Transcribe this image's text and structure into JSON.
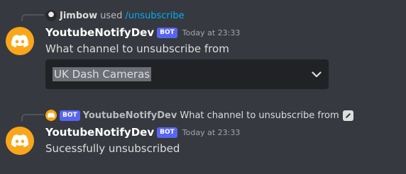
{
  "message1": {
    "reply": {
      "user": "Jimbow",
      "used_text": "used",
      "command": "/unsubscribe"
    },
    "author": "YoutubeNotifyDev",
    "bot_tag": "BOT",
    "timestamp": "Today at 23:33",
    "content": "What channel to unsubscribe from",
    "select": {
      "selected_value": "UK Dash Cameras"
    }
  },
  "message2": {
    "reply": {
      "bot_tag": "BOT",
      "author": "YoutubeNotifyDev",
      "text": "What channel to unsubscribe from"
    },
    "author": "YoutubeNotifyDev",
    "bot_tag": "BOT",
    "timestamp": "Today at 23:33",
    "content": "Sucessfully unsubscribed"
  },
  "colors": {
    "background": "#36393f",
    "blurple": "#5865f2",
    "avatar": "#faa61a",
    "link": "#00aff4",
    "select_bg": "#202225"
  },
  "icons": {
    "avatar": "discord-logo-icon",
    "dropdown": "chevron-down-icon",
    "edited": "pencil-icon"
  }
}
